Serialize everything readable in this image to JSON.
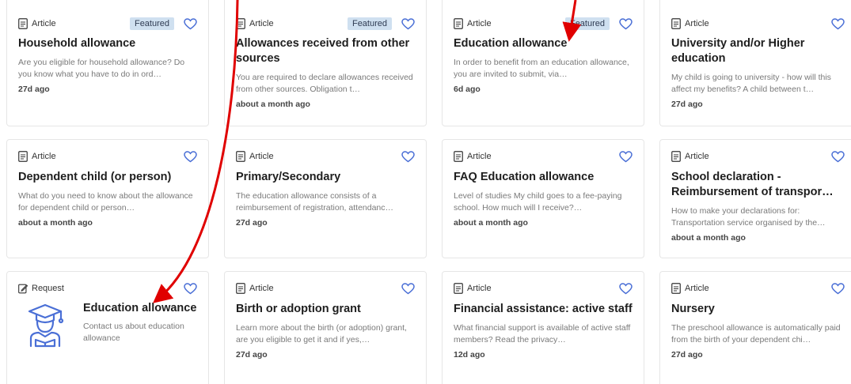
{
  "cards": [
    {
      "type": "Article",
      "featured": "Featured",
      "title": "Household allowance",
      "desc": "Are you eligible for household allowance? Do you know what you have to do in ord…",
      "date": "27d ago"
    },
    {
      "type": "Article",
      "featured": "Featured",
      "title": "Allowances received from other sources",
      "desc": "You are required to declare allowances received from other sources. Obligation t…",
      "date": "about a month ago"
    },
    {
      "type": "Article",
      "featured": "Featured",
      "title": "Education allowance",
      "desc": "In order to benefit from an education allowance, you are invited to submit, via…",
      "date": "6d ago"
    },
    {
      "type": "Article",
      "featured": "",
      "title": "University and/or Higher education",
      "desc": "My child is going to university - how will this affect my benefits? A child between t…",
      "date": "27d ago"
    },
    {
      "type": "Article",
      "featured": "",
      "title": "Dependent child (or person)",
      "desc": "What do you need to know about the allowance for dependent child or person…",
      "date": "about a month ago"
    },
    {
      "type": "Article",
      "featured": "",
      "title": "Primary/Secondary",
      "desc": "The education allowance consists of a reimbursement of registration, attendanc…",
      "date": "27d ago"
    },
    {
      "type": "Article",
      "featured": "",
      "title": "FAQ Education allowance",
      "desc": "Level of studies My child goes to a fee-paying school. How much will I receive?…",
      "date": "about a month ago"
    },
    {
      "type": "Article",
      "featured": "",
      "title": "School declaration - Reimbursement of transpor…",
      "desc": "How to make your declarations for: Transportation service organised by the…",
      "date": "about a month ago"
    },
    {
      "type": "Request",
      "featured": "",
      "title": "Education allowance",
      "desc": "Contact us about education allowance",
      "date": ""
    },
    {
      "type": "Article",
      "featured": "",
      "title": "Birth or adoption grant",
      "desc": "Learn more about the birth (or adoption) grant, are you eligible to get it and if yes,…",
      "date": "27d ago"
    },
    {
      "type": "Article",
      "featured": "",
      "title": "Financial assistance: active staff",
      "desc": "What financial support is available of active staff members? Read the privacy…",
      "date": "12d ago"
    },
    {
      "type": "Article",
      "featured": "",
      "title": "Nursery",
      "desc": "The preschool allowance is automatically paid from the birth of your dependent chi…",
      "date": "27d ago"
    }
  ],
  "colors": {
    "accent": "#4a6fd6",
    "badge_bg": "#cfe0f0",
    "arrow": "#e00000"
  }
}
